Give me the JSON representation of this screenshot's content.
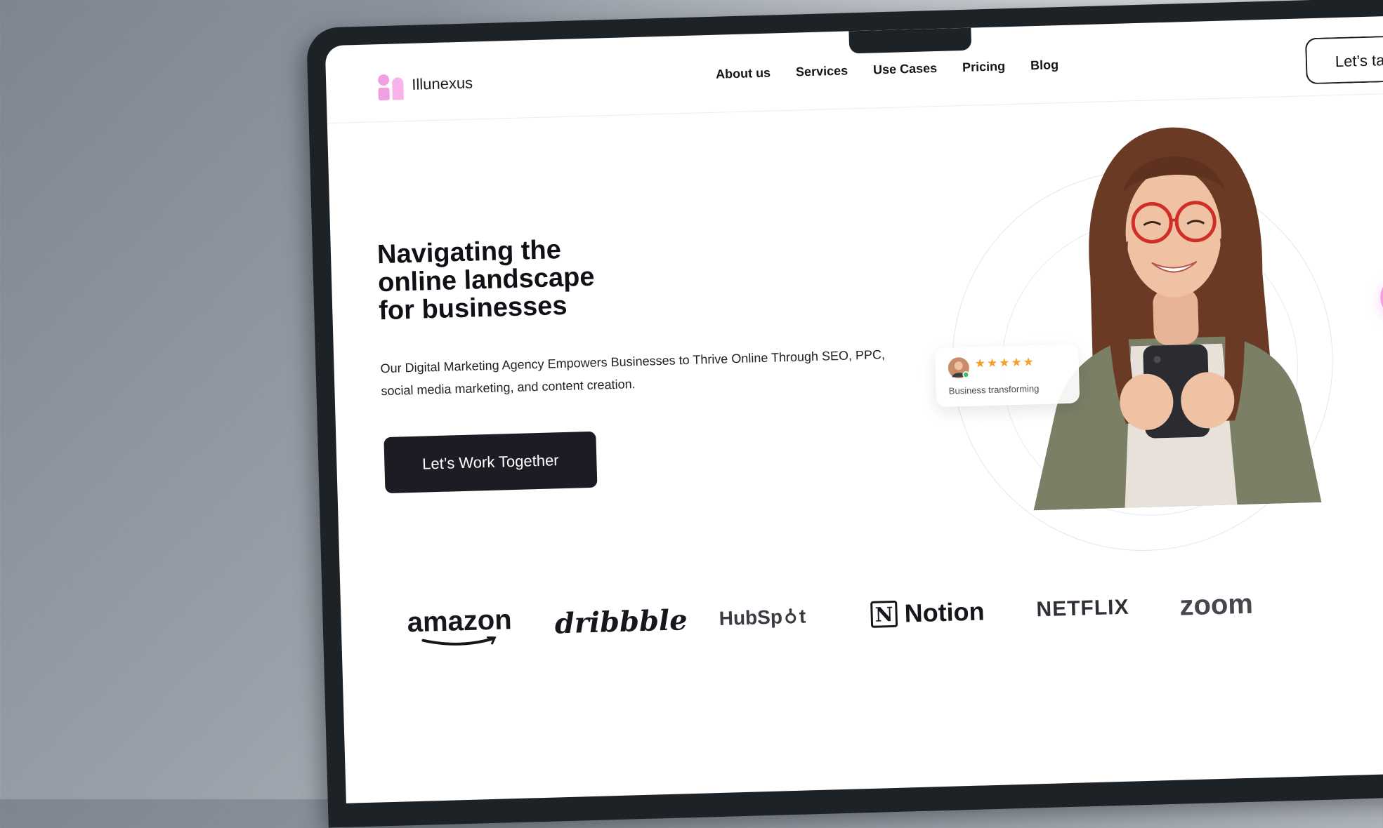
{
  "site": {
    "brand_name": "Illunexus",
    "brand_color": "#f29ee3",
    "accent_dark": "#1b1c24"
  },
  "nav": {
    "items": [
      {
        "label": "About us"
      },
      {
        "label": "Services"
      },
      {
        "label": "Use Cases"
      },
      {
        "label": "Pricing"
      },
      {
        "label": "Blog"
      }
    ],
    "cta_label": "Let’s ta"
  },
  "hero": {
    "title_lines": [
      "Navigating the",
      "online landscape",
      "for businesses"
    ],
    "description": "Our Digital Marketing Agency Empowers Businesses to Thrive Online Through SEO, PPC, social media marketing, and content creation.",
    "cta_label": "Let’s Work Together",
    "review_card": {
      "stars": "★★★★★",
      "rating": 5,
      "text": "Business transforming",
      "star_color": "#f5a02a"
    },
    "shield_icon": "shield-check-icon",
    "pattern_color": "#38bcd6"
  },
  "brands": [
    {
      "name": "amazon"
    },
    {
      "name": "dribbble"
    },
    {
      "name": "HubSpot",
      "parts": [
        "HubSp",
        "t"
      ]
    },
    {
      "name": "Notion",
      "mark": "N"
    },
    {
      "name": "NETFLIX"
    },
    {
      "name": "zoom"
    }
  ]
}
